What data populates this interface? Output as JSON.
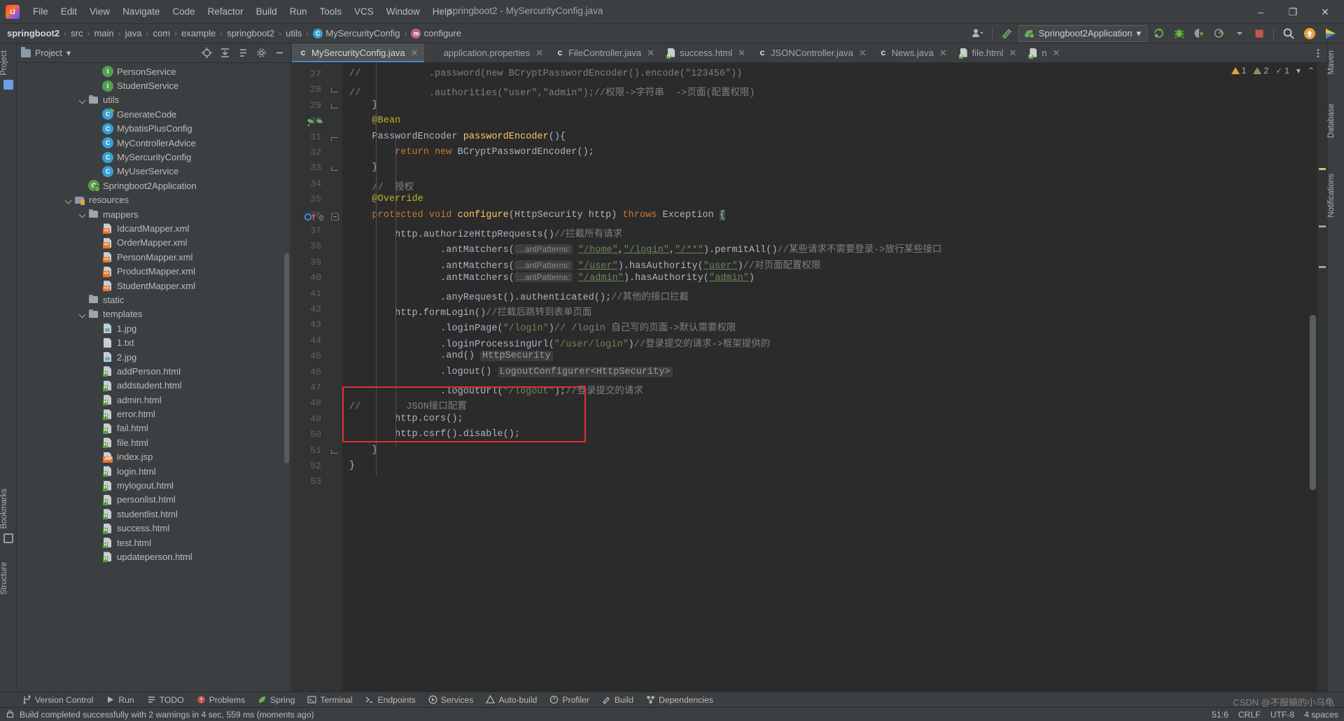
{
  "window": {
    "title": "springboot2 - MySercurityConfig.java",
    "minimize": "–",
    "maximize": "❐",
    "close": "✕"
  },
  "menu": [
    {
      "label": "File"
    },
    {
      "label": "Edit"
    },
    {
      "label": "View"
    },
    {
      "label": "Navigate"
    },
    {
      "label": "Code"
    },
    {
      "label": "Refactor"
    },
    {
      "label": "Build"
    },
    {
      "label": "Run"
    },
    {
      "label": "Tools"
    },
    {
      "label": "VCS"
    },
    {
      "label": "Window"
    },
    {
      "label": "Help"
    }
  ],
  "breadcrumb": [
    {
      "label": "springboot2",
      "icon": "none",
      "bold": true
    },
    {
      "label": "src",
      "icon": "none"
    },
    {
      "label": "main",
      "icon": "none"
    },
    {
      "label": "java",
      "icon": "none"
    },
    {
      "label": "com",
      "icon": "none"
    },
    {
      "label": "example",
      "icon": "none"
    },
    {
      "label": "springboot2",
      "icon": "none"
    },
    {
      "label": "utils",
      "icon": "none"
    },
    {
      "label": "MySercurityConfig",
      "icon": "class"
    },
    {
      "label": "configure",
      "icon": "method"
    }
  ],
  "toolbar": {
    "run_config": "Springboot2Application",
    "run_config_dropdown": "▾",
    "icons": [
      "user-avatar-icon",
      "hammer-build-icon",
      "rerun-icon",
      "debug-icon",
      "coverage-icon",
      "profiler-icon",
      "stop-icon",
      "search-everywhere-icon",
      "updates-icon",
      "ide-feature-icon"
    ]
  },
  "left_strip": [
    {
      "label": "Project"
    },
    {
      "label": "Bookmarks"
    },
    {
      "label": "Structure"
    }
  ],
  "right_strip": [
    {
      "label": "Maven"
    },
    {
      "label": "Database"
    },
    {
      "label": "Notifications"
    }
  ],
  "project_panel": {
    "title": "Project",
    "dropdown": "▾",
    "actions": [
      "locate-icon",
      "collapse-all-icon",
      "expand-icon",
      "settings-gear-icon",
      "hide-icon"
    ],
    "tree": [
      {
        "indent": 5,
        "icon": "interface",
        "label": "PersonService"
      },
      {
        "indent": 5,
        "icon": "interface",
        "label": "StudentService"
      },
      {
        "indent": 4,
        "icon": "folder",
        "label": "utils",
        "expanded": true
      },
      {
        "indent": 5,
        "icon": "run-class",
        "label": "GenerateCode"
      },
      {
        "indent": 5,
        "icon": "class",
        "label": "MybatisPlusConfig"
      },
      {
        "indent": 5,
        "icon": "class",
        "label": "MyControllerAdvice"
      },
      {
        "indent": 5,
        "icon": "class",
        "label": "MySercurityConfig"
      },
      {
        "indent": 5,
        "icon": "class",
        "label": "MyUserService"
      },
      {
        "indent": 4,
        "icon": "spring",
        "label": "Springboot2Application"
      },
      {
        "indent": 3,
        "icon": "resources",
        "label": "resources",
        "expanded": true
      },
      {
        "indent": 4,
        "icon": "folder",
        "label": "mappers",
        "expanded": true
      },
      {
        "indent": 5,
        "icon": "xml",
        "label": "IdcardMapper.xml"
      },
      {
        "indent": 5,
        "icon": "xml",
        "label": "OrderMapper.xml"
      },
      {
        "indent": 5,
        "icon": "xml",
        "label": "PersonMapper.xml"
      },
      {
        "indent": 5,
        "icon": "xml",
        "label": "ProductMapper.xml"
      },
      {
        "indent": 5,
        "icon": "xml",
        "label": "StudentMapper.xml"
      },
      {
        "indent": 4,
        "icon": "folder",
        "label": "static"
      },
      {
        "indent": 4,
        "icon": "folder",
        "label": "templates",
        "expanded": true
      },
      {
        "indent": 5,
        "icon": "image",
        "label": "1.jpg"
      },
      {
        "indent": 5,
        "icon": "text",
        "label": "1.txt"
      },
      {
        "indent": 5,
        "icon": "image",
        "label": "2.jpg"
      },
      {
        "indent": 5,
        "icon": "html",
        "label": "addPerson.html"
      },
      {
        "indent": 5,
        "icon": "html",
        "label": "addstudent.html"
      },
      {
        "indent": 5,
        "icon": "html",
        "label": "admin.html"
      },
      {
        "indent": 5,
        "icon": "html",
        "label": "error.html"
      },
      {
        "indent": 5,
        "icon": "html",
        "label": "fail.html"
      },
      {
        "indent": 5,
        "icon": "html",
        "label": "file.html"
      },
      {
        "indent": 5,
        "icon": "jsp",
        "label": "index.jsp"
      },
      {
        "indent": 5,
        "icon": "html",
        "label": "login.html"
      },
      {
        "indent": 5,
        "icon": "html",
        "label": "mylogout.html"
      },
      {
        "indent": 5,
        "icon": "html",
        "label": "personlist.html"
      },
      {
        "indent": 5,
        "icon": "html",
        "label": "studentlist.html"
      },
      {
        "indent": 5,
        "icon": "html",
        "label": "success.html"
      },
      {
        "indent": 5,
        "icon": "html",
        "label": "test.html"
      },
      {
        "indent": 5,
        "icon": "html",
        "label": "updateperson.html"
      }
    ]
  },
  "editor_tabs": [
    {
      "label": "MySercurityConfig.java",
      "icon": "class",
      "active": true
    },
    {
      "label": "application.properties",
      "icon": "properties",
      "active": false
    },
    {
      "label": "FileController.java",
      "icon": "class",
      "active": false
    },
    {
      "label": "success.html",
      "icon": "html",
      "active": false
    },
    {
      "label": "JSONController.java",
      "icon": "class",
      "active": false
    },
    {
      "label": "News.java",
      "icon": "class",
      "active": false
    },
    {
      "label": "file.html",
      "icon": "html",
      "active": false
    },
    {
      "label": "n",
      "icon": "html",
      "active": false
    }
  ],
  "editor_inspection": {
    "warnings": "1",
    "weak_warnings": "2",
    "checks": "1",
    "collapse": "▾",
    "expand": "⌃"
  },
  "code": {
    "first_line_number": 27,
    "lines": [
      {
        "n": 27,
        "html": "<span class=\"cmt\">//            .password(new BCryptPasswordEncoder().encode(\"123456\"))</span>"
      },
      {
        "n": 28,
        "html": "<span class=\"cmt\">//            .authorities(\"user\",\"admin\");//权限->字符串  ->页面(配置权限)</span>"
      },
      {
        "n": 29,
        "html": "    }"
      },
      {
        "n": 30,
        "html": "    <span class=\"ann\">@Bean</span>"
      },
      {
        "n": 31,
        "html": "    PasswordEncoder <span class=\"meth\">passwordEncoder</span>(){"
      },
      {
        "n": 32,
        "html": "        <span class=\"kw\">return new</span> BCryptPasswordEncoder();"
      },
      {
        "n": 33,
        "html": "    }"
      },
      {
        "n": 34,
        "html": "    <span class=\"cmt\">//  授权</span>"
      },
      {
        "n": 35,
        "html": "    <span class=\"ann\">@Override</span>"
      },
      {
        "n": 36,
        "html": "    <span class=\"kw\">protected void</span> <span class=\"meth\">configure</span>(HttpSecurity http) <span class=\"kw\">throws</span> Exception <span class=\"highlight-brace\">{</span>"
      },
      {
        "n": 37,
        "html": "        http.authorizeHttpRequests()<span class=\"cmt\">//拦截所有请求</span>"
      },
      {
        "n": 38,
        "html": "                .antMatchers(<span class=\"hint\">…antPatterns:</span> <span class=\"linkstr\">\"/home\"</span>,<span class=\"linkstr\">\"/login\"</span>,<span class=\"linkstr\">\"/**\"</span>).permitAll()<span class=\"cmt\">//某些请求不需要登录->放行某些接口</span>"
      },
      {
        "n": 39,
        "html": "                .antMatchers(<span class=\"hint\">…antPatterns:</span> <span class=\"linkstr\">\"/user\"</span>).hasAuthority(<span class=\"linkstr\">\"user\"</span>)<span class=\"cmt\">//对页面配置权限</span>"
      },
      {
        "n": 40,
        "html": "                .antMatchers(<span class=\"hint\">…antPatterns:</span> <span class=\"linkstr\">\"/admin\"</span>).hasAuthority(<span class=\"linkstr\">\"admin\"</span>)"
      },
      {
        "n": 41,
        "html": "                .anyRequest().authenticated();<span class=\"cmt\">//其他的接口拦截</span>"
      },
      {
        "n": 42,
        "html": "        http.formLogin()<span class=\"cmt\">//拦截后跳转到表单页面</span>"
      },
      {
        "n": 43,
        "html": "                .loginPage(<span class=\"str\">\"/login\"</span>)<span class=\"cmt\">// /login 自己写的页面->默认需要权限</span>"
      },
      {
        "n": 44,
        "html": "                .loginProcessingUrl(<span class=\"str\">\"/user/login\"</span>)<span class=\"cmt\">//登录提交的请求->框架提供的</span>"
      },
      {
        "n": 45,
        "html": "                .and() <span class=\"greybox\">HttpSecurity</span>"
      },
      {
        "n": 46,
        "html": "                .logout() <span class=\"greybox\">LogoutConfigurer&lt;HttpSecurity&gt;</span>"
      },
      {
        "n": 47,
        "html": "                .logoutUrl(<span class=\"str\">\"/logout\"</span>);<span class=\"cmt\">//登录提交的请求</span>"
      },
      {
        "n": 48,
        "html": "<span class=\"cmt\">//        JSON接口配置</span>"
      },
      {
        "n": 49,
        "html": "        http.cors();"
      },
      {
        "n": 50,
        "html": "        http.csrf().disable();"
      },
      {
        "n": 51,
        "html": "    }"
      },
      {
        "n": 52,
        "html": "}"
      },
      {
        "n": 53,
        "html": ""
      }
    ]
  },
  "bottom_bar": [
    {
      "label": "Version Control",
      "icon": "branch-icon"
    },
    {
      "label": "Run",
      "icon": "play-icon"
    },
    {
      "label": "TODO",
      "icon": "todo-icon"
    },
    {
      "label": "Problems",
      "icon": "problems-icon"
    },
    {
      "label": "Spring",
      "icon": "spring-leaf-icon"
    },
    {
      "label": "Terminal",
      "icon": "terminal-icon"
    },
    {
      "label": "Endpoints",
      "icon": "endpoints-icon"
    },
    {
      "label": "Services",
      "icon": "services-icon"
    },
    {
      "label": "Auto-build",
      "icon": "autobuild-icon"
    },
    {
      "label": "Profiler",
      "icon": "profiler-icon"
    },
    {
      "label": "Build",
      "icon": "hammer-icon"
    },
    {
      "label": "Dependencies",
      "icon": "dependencies-icon"
    }
  ],
  "status_bar": {
    "message": "Build completed successfully with 2 warnings in 4 sec, 559 ms (moments ago)",
    "caret": "51:6",
    "line_separator": "CRLF",
    "encoding": "UTF-8",
    "indent": "4 spaces",
    "lock_icon": "lock-icon"
  },
  "watermark": "CSDN @不服输的小乌龟",
  "colors": {
    "accent": "#4a88c7",
    "editor_bg": "#2b2b2b",
    "panel_bg": "#3c3f41",
    "redbox": "#e03030",
    "warn": "#d9a441",
    "green": "#62b543"
  }
}
